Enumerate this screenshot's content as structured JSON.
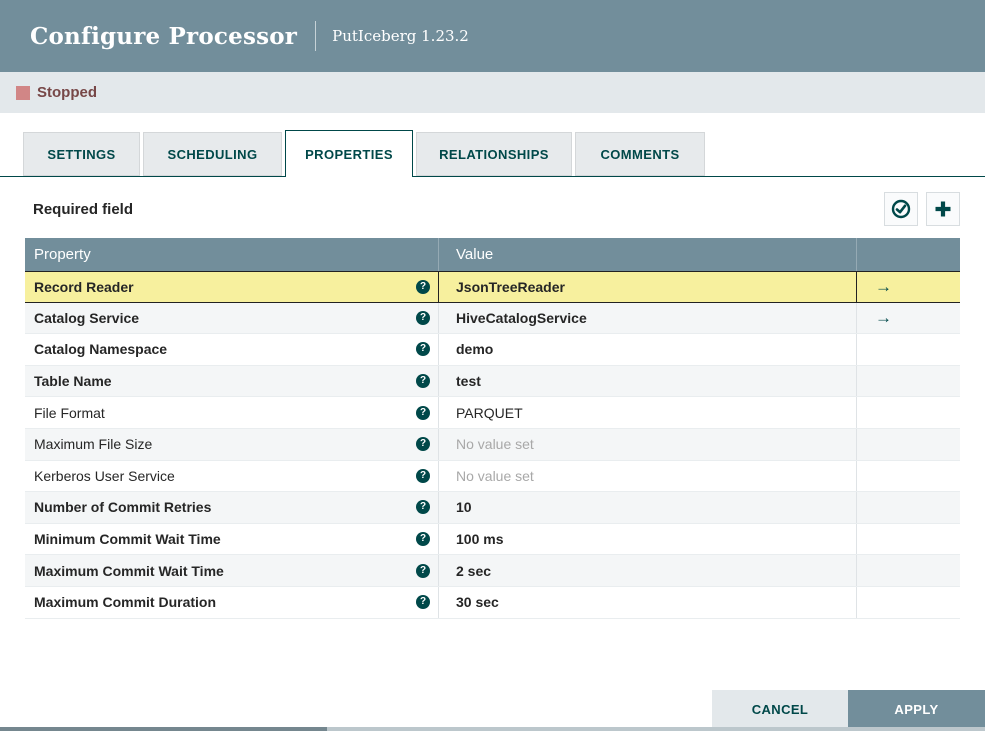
{
  "dialog": {
    "title": "Configure Processor",
    "subtitle": "PutIceberg 1.23.2"
  },
  "status": {
    "label": "Stopped",
    "color": "#d18686",
    "text_color": "#774747"
  },
  "tabs": [
    {
      "label": "SETTINGS",
      "active": false
    },
    {
      "label": "SCHEDULING",
      "active": false
    },
    {
      "label": "PROPERTIES",
      "active": true
    },
    {
      "label": "RELATIONSHIPS",
      "active": false
    },
    {
      "label": "COMMENTS",
      "active": false
    }
  ],
  "properties_panel": {
    "required_note": "Required field",
    "icons": {
      "verify": "check-circle-icon",
      "add": "plus-icon",
      "help_glyph": "?",
      "goto_glyph": "→"
    },
    "table": {
      "columns": [
        "Property",
        "Value"
      ],
      "rows": [
        {
          "property": "Record Reader",
          "value": "JsonTreeReader",
          "bold": true,
          "unset": false,
          "has_goto": true,
          "highlighted": true
        },
        {
          "property": "Catalog Service",
          "value": "HiveCatalogService",
          "bold": true,
          "unset": false,
          "has_goto": true,
          "highlighted": false
        },
        {
          "property": "Catalog Namespace",
          "value": "demo",
          "bold": true,
          "unset": false,
          "has_goto": false,
          "highlighted": false
        },
        {
          "property": "Table Name",
          "value": "test",
          "bold": true,
          "unset": false,
          "has_goto": false,
          "highlighted": false
        },
        {
          "property": "File Format",
          "value": "PARQUET",
          "bold": false,
          "unset": false,
          "has_goto": false,
          "highlighted": false
        },
        {
          "property": "Maximum File Size",
          "value": "No value set",
          "bold": false,
          "unset": true,
          "has_goto": false,
          "highlighted": false
        },
        {
          "property": "Kerberos User Service",
          "value": "No value set",
          "bold": false,
          "unset": true,
          "has_goto": false,
          "highlighted": false
        },
        {
          "property": "Number of Commit Retries",
          "value": "10",
          "bold": true,
          "unset": false,
          "has_goto": false,
          "highlighted": false
        },
        {
          "property": "Minimum Commit Wait Time",
          "value": "100 ms",
          "bold": true,
          "unset": false,
          "has_goto": false,
          "highlighted": false
        },
        {
          "property": "Maximum Commit Wait Time",
          "value": "2 sec",
          "bold": true,
          "unset": false,
          "has_goto": false,
          "highlighted": false
        },
        {
          "property": "Maximum Commit Duration",
          "value": "30 sec",
          "bold": true,
          "unset": false,
          "has_goto": false,
          "highlighted": false
        }
      ]
    }
  },
  "footer": {
    "cancel_label": "CANCEL",
    "apply_label": "APPLY"
  },
  "colors": {
    "header_bg": "#728e9b",
    "accent_teal": "#004849",
    "status_bar_bg": "#e3e8eb",
    "highlight_row": "#f7f09e",
    "alt_row": "#f4f6f7",
    "unset_text": "#a8a8a8"
  }
}
